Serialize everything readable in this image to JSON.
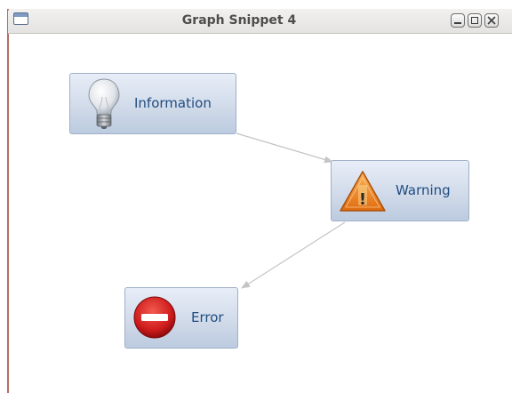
{
  "window": {
    "title": "Graph Snippet 4"
  },
  "graph": {
    "nodes": [
      {
        "id": "information",
        "label": "Information",
        "icon": "lightbulb-icon"
      },
      {
        "id": "warning",
        "label": "Warning",
        "icon": "warning-triangle-icon"
      },
      {
        "id": "error",
        "label": "Error",
        "icon": "error-stop-icon"
      }
    ],
    "edges": [
      {
        "from": "Information",
        "to": "Warning"
      },
      {
        "from": "Warning",
        "to": "Error"
      }
    ]
  },
  "colors": {
    "node_text": "#1f4c80",
    "edge": "#c4c4c4",
    "warning": "#f08a1c",
    "error": "#d01f1f"
  }
}
